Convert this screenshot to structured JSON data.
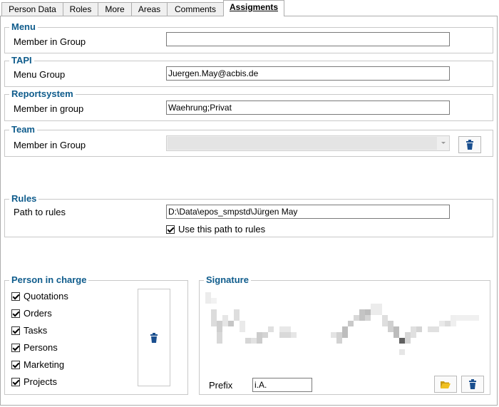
{
  "tabs": [
    "Person Data",
    "Roles",
    "More",
    "Areas",
    "Comments",
    "Assigments"
  ],
  "menu": {
    "legend": "Menu",
    "label": "Member in Group",
    "value": ""
  },
  "tapi": {
    "legend": "TAPI",
    "label": "Menu Group",
    "value": "Juergen.May@acbis.de"
  },
  "reportsystem": {
    "legend": "Reportsystem",
    "label": "Member in group",
    "value": "Waehrung;Privat"
  },
  "team": {
    "legend": "Team",
    "label": "Member in Group",
    "value": "",
    "delete_icon": "trash-icon"
  },
  "rules": {
    "legend": "Rules",
    "label": "Path to rules",
    "value": "D:\\Data\\epos_smpstd\\Jürgen May",
    "checkbox_label": "Use this path to rules",
    "checked": true
  },
  "person_in_charge": {
    "legend": "Person in charge",
    "items": [
      {
        "label": "Quotations",
        "checked": true
      },
      {
        "label": "Orders",
        "checked": true
      },
      {
        "label": "Tasks",
        "checked": true
      },
      {
        "label": "Persons",
        "checked": true
      },
      {
        "label": "Marketing",
        "checked": true
      },
      {
        "label": "Projects",
        "checked": true
      }
    ],
    "delete_icon": "trash-icon"
  },
  "signature": {
    "legend": "Signature",
    "prefix_label": "Prefix",
    "prefix_value": "i.A.",
    "open_icon": "folder-icon",
    "delete_icon": "trash-icon"
  },
  "colors": {
    "accent": "#0f5c8c",
    "icon_blue": "#1a4f8f",
    "folder_yellow": "#f0c020"
  }
}
